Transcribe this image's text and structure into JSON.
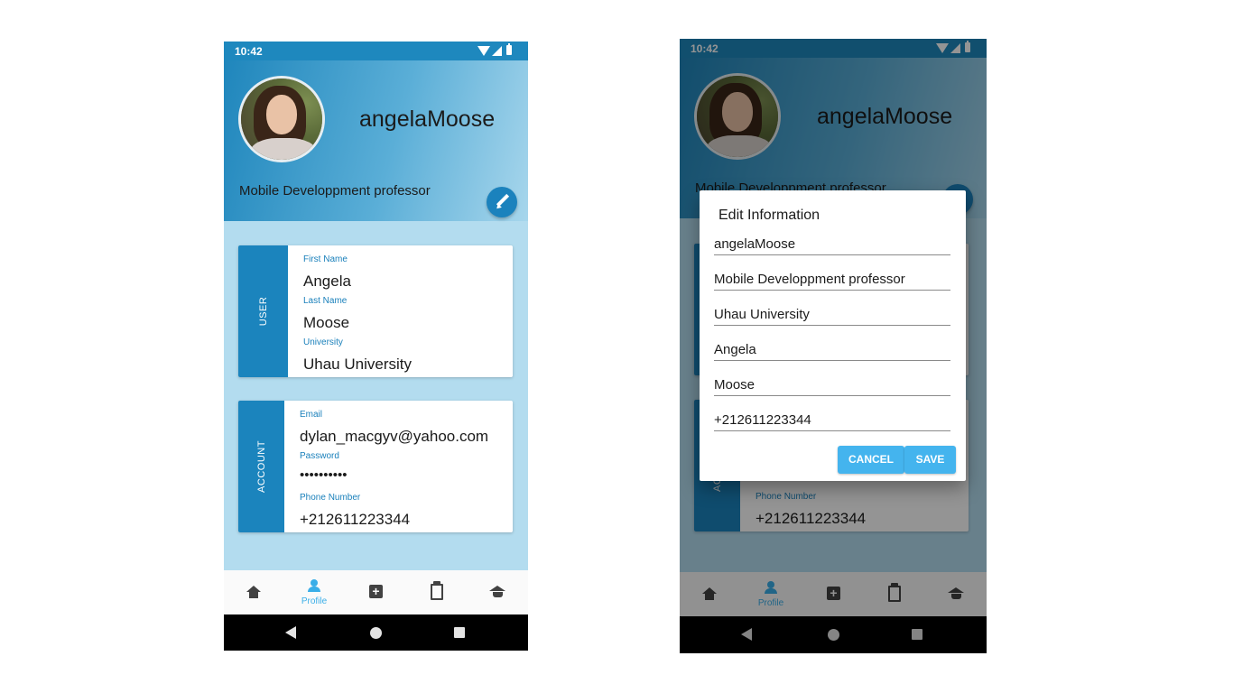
{
  "status_bar": {
    "time": "10:42"
  },
  "profile": {
    "username": "angelaMoose",
    "bio": "Mobile Developpment professor"
  },
  "user_card": {
    "section_label": "USER",
    "fields": [
      {
        "label": "First Name",
        "value": "Angela"
      },
      {
        "label": "Last Name",
        "value": "Moose"
      },
      {
        "label": "University",
        "value": "Uhau University"
      }
    ]
  },
  "account_card": {
    "section_label": "ACCOUNT",
    "fields": [
      {
        "label": "Email",
        "value": "dylan_macgyv@yahoo.com"
      },
      {
        "label": "Password",
        "value": "••••••••••"
      },
      {
        "label": "Phone Number",
        "value": "+212611223344"
      }
    ]
  },
  "bottom_nav": {
    "items": [
      {
        "icon": "home-icon",
        "label": ""
      },
      {
        "icon": "person-icon",
        "label": "Profile",
        "active": true
      },
      {
        "icon": "add-box-icon",
        "label": ""
      },
      {
        "icon": "clipboard-icon",
        "label": ""
      },
      {
        "icon": "school-icon",
        "label": ""
      }
    ]
  },
  "edit_dialog": {
    "title": "Edit Information",
    "fields": [
      {
        "value": "angelaMoose"
      },
      {
        "value": "Mobile Developpment professor"
      },
      {
        "value": "Uhau University"
      },
      {
        "value": "Angela"
      },
      {
        "value": "Moose"
      },
      {
        "value": "+212611223344"
      }
    ],
    "cancel_label": "CANCEL",
    "save_label": "SAVE"
  },
  "colors": {
    "primary": "#1b84bd",
    "accent": "#44b4ee",
    "background": "#b3dcef",
    "active_nav": "#3aaee8"
  }
}
